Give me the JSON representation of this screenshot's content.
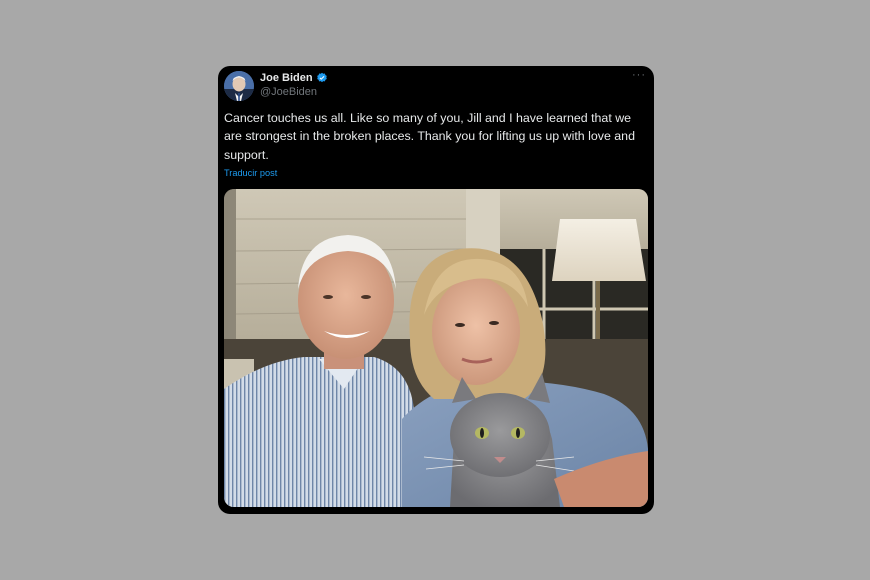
{
  "tweet": {
    "author_name": "Joe Biden",
    "author_handle": "@JoeBiden",
    "verified": true,
    "text": "Cancer touches us all. Like so many of you, Jill and I have learned that we are strongest in the broken places. Thank you for lifting us up with love and support.",
    "translate_label": "Traducir post",
    "more_label": "···",
    "colors": {
      "card_bg": "#000000",
      "page_bg": "#a8a8a8",
      "link": "#1d9bf0",
      "verified": "#1d9bf0",
      "handle": "#71767b"
    }
  },
  "icons": {
    "verified": "verified-badge-icon",
    "more": "more-options-icon"
  }
}
